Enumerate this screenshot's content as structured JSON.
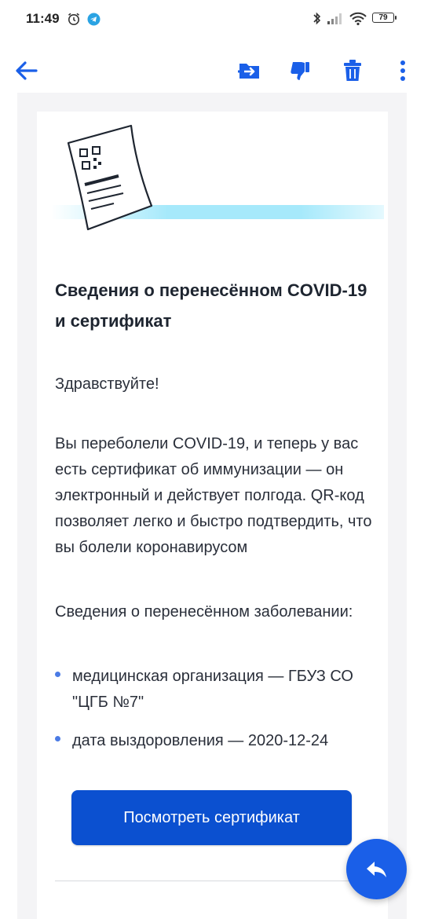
{
  "status_bar": {
    "time": "11:49",
    "battery": "79",
    "icons": [
      "alarm-icon",
      "telegram-icon",
      "bluetooth-icon",
      "signal-icon",
      "wifi-icon",
      "battery-icon"
    ]
  },
  "toolbar": {
    "icons": [
      "back-arrow-icon",
      "move-to-folder-icon",
      "spam-icon",
      "trash-icon",
      "more-vertical-icon"
    ],
    "accent_color": "#1a5fe8"
  },
  "email": {
    "heading": "Сведения о перенесённом COVID-19 и сертификат",
    "greeting": "Здравствуйте!",
    "body": "Вы переболели COVID-19, и теперь у вас есть сертификат об иммунизации — он электронный и действует полгода. QR-код позволяет легко и быстро подтвердить, что вы болели коронавирусом",
    "details_title": "Сведения о перенесённом заболевании:",
    "details": [
      "медицинская организация — ГБУЗ СО \"ЦГБ №7\"",
      "дата выздоровления — 2020-12-24"
    ],
    "button_label": "Посмотреть сертификат",
    "button_color": "#0b50d0"
  },
  "fab": {
    "icon": "reply-icon"
  }
}
